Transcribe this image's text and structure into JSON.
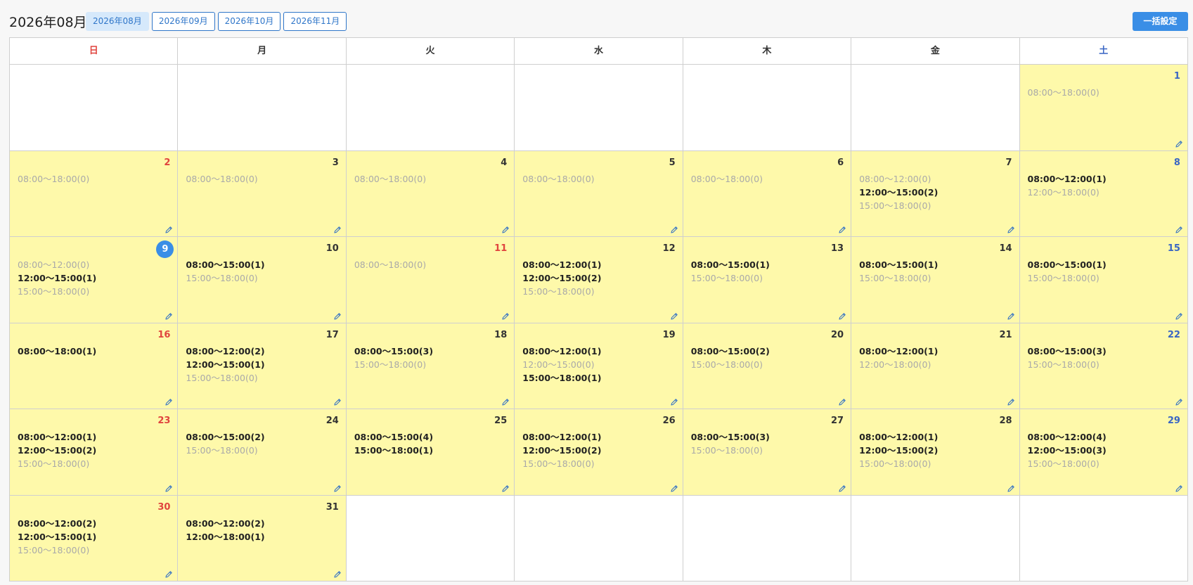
{
  "header": {
    "title": "2026年08月",
    "tabs": [
      {
        "label": "2026年08月",
        "active": true
      },
      {
        "label": "2026年09月",
        "active": false
      },
      {
        "label": "2026年10月",
        "active": false
      },
      {
        "label": "2026年11月",
        "active": false
      }
    ],
    "bulk_button": "一括設定"
  },
  "colors": {
    "filled_cell": "#fef9aa",
    "sunday": "#e0443e",
    "saturday": "#3a66c4",
    "accent": "#3a8ee6"
  },
  "weekdays": [
    {
      "label": "日",
      "kind": "sun"
    },
    {
      "label": "月",
      "kind": ""
    },
    {
      "label": "火",
      "kind": ""
    },
    {
      "label": "水",
      "kind": ""
    },
    {
      "label": "木",
      "kind": ""
    },
    {
      "label": "金",
      "kind": ""
    },
    {
      "label": "土",
      "kind": "sat"
    }
  ],
  "weeks": [
    [
      null,
      null,
      null,
      null,
      null,
      null,
      {
        "day": "1",
        "kind": "sat",
        "slots": [
          {
            "t": "08:00〜18:00(0)",
            "b": false
          }
        ]
      }
    ],
    [
      {
        "day": "2",
        "kind": "sun",
        "slots": [
          {
            "t": "08:00〜18:00(0)",
            "b": false
          }
        ]
      },
      {
        "day": "3",
        "kind": "",
        "slots": [
          {
            "t": "08:00〜18:00(0)",
            "b": false
          }
        ]
      },
      {
        "day": "4",
        "kind": "",
        "slots": [
          {
            "t": "08:00〜18:00(0)",
            "b": false
          }
        ]
      },
      {
        "day": "5",
        "kind": "",
        "slots": [
          {
            "t": "08:00〜18:00(0)",
            "b": false
          }
        ]
      },
      {
        "day": "6",
        "kind": "",
        "slots": [
          {
            "t": "08:00〜18:00(0)",
            "b": false
          }
        ]
      },
      {
        "day": "7",
        "kind": "",
        "slots": [
          {
            "t": "08:00〜12:00(0)",
            "b": false
          },
          {
            "t": "12:00〜15:00(2)",
            "b": true
          },
          {
            "t": "15:00〜18:00(0)",
            "b": false
          }
        ]
      },
      {
        "day": "8",
        "kind": "sat",
        "slots": [
          {
            "t": "08:00〜12:00(1)",
            "b": true
          },
          {
            "t": "12:00〜18:00(0)",
            "b": false
          }
        ]
      }
    ],
    [
      {
        "day": "9",
        "kind": "today",
        "slots": [
          {
            "t": "08:00〜12:00(0)",
            "b": false
          },
          {
            "t": "12:00〜15:00(1)",
            "b": true
          },
          {
            "t": "15:00〜18:00(0)",
            "b": false
          }
        ]
      },
      {
        "day": "10",
        "kind": "",
        "slots": [
          {
            "t": "08:00〜15:00(1)",
            "b": true
          },
          {
            "t": "15:00〜18:00(0)",
            "b": false
          }
        ]
      },
      {
        "day": "11",
        "kind": "sun",
        "slots": [
          {
            "t": "08:00〜18:00(0)",
            "b": false
          }
        ]
      },
      {
        "day": "12",
        "kind": "",
        "slots": [
          {
            "t": "08:00〜12:00(1)",
            "b": true
          },
          {
            "t": "12:00〜15:00(2)",
            "b": true
          },
          {
            "t": "15:00〜18:00(0)",
            "b": false
          }
        ]
      },
      {
        "day": "13",
        "kind": "",
        "slots": [
          {
            "t": "08:00〜15:00(1)",
            "b": true
          },
          {
            "t": "15:00〜18:00(0)",
            "b": false
          }
        ]
      },
      {
        "day": "14",
        "kind": "",
        "slots": [
          {
            "t": "08:00〜15:00(1)",
            "b": true
          },
          {
            "t": "15:00〜18:00(0)",
            "b": false
          }
        ]
      },
      {
        "day": "15",
        "kind": "sat",
        "slots": [
          {
            "t": "08:00〜15:00(1)",
            "b": true
          },
          {
            "t": "15:00〜18:00(0)",
            "b": false
          }
        ]
      }
    ],
    [
      {
        "day": "16",
        "kind": "sun",
        "slots": [
          {
            "t": "08:00〜18:00(1)",
            "b": true
          }
        ]
      },
      {
        "day": "17",
        "kind": "",
        "slots": [
          {
            "t": "08:00〜12:00(2)",
            "b": true
          },
          {
            "t": "12:00〜15:00(1)",
            "b": true
          },
          {
            "t": "15:00〜18:00(0)",
            "b": false
          }
        ]
      },
      {
        "day": "18",
        "kind": "",
        "slots": [
          {
            "t": "08:00〜15:00(3)",
            "b": true
          },
          {
            "t": "15:00〜18:00(0)",
            "b": false
          }
        ]
      },
      {
        "day": "19",
        "kind": "",
        "slots": [
          {
            "t": "08:00〜12:00(1)",
            "b": true
          },
          {
            "t": "12:00〜15:00(0)",
            "b": false
          },
          {
            "t": "15:00〜18:00(1)",
            "b": true
          }
        ]
      },
      {
        "day": "20",
        "kind": "",
        "slots": [
          {
            "t": "08:00〜15:00(2)",
            "b": true
          },
          {
            "t": "15:00〜18:00(0)",
            "b": false
          }
        ]
      },
      {
        "day": "21",
        "kind": "",
        "slots": [
          {
            "t": "08:00〜12:00(1)",
            "b": true
          },
          {
            "t": "12:00〜18:00(0)",
            "b": false
          }
        ]
      },
      {
        "day": "22",
        "kind": "sat",
        "slots": [
          {
            "t": "08:00〜15:00(3)",
            "b": true
          },
          {
            "t": "15:00〜18:00(0)",
            "b": false
          }
        ]
      }
    ],
    [
      {
        "day": "23",
        "kind": "sun",
        "slots": [
          {
            "t": "08:00〜12:00(1)",
            "b": true
          },
          {
            "t": "12:00〜15:00(2)",
            "b": true
          },
          {
            "t": "15:00〜18:00(0)",
            "b": false
          }
        ]
      },
      {
        "day": "24",
        "kind": "",
        "slots": [
          {
            "t": "08:00〜15:00(2)",
            "b": true
          },
          {
            "t": "15:00〜18:00(0)",
            "b": false
          }
        ]
      },
      {
        "day": "25",
        "kind": "",
        "slots": [
          {
            "t": "08:00〜15:00(4)",
            "b": true
          },
          {
            "t": "15:00〜18:00(1)",
            "b": true
          }
        ]
      },
      {
        "day": "26",
        "kind": "",
        "slots": [
          {
            "t": "08:00〜12:00(1)",
            "b": true
          },
          {
            "t": "12:00〜15:00(2)",
            "b": true
          },
          {
            "t": "15:00〜18:00(0)",
            "b": false
          }
        ]
      },
      {
        "day": "27",
        "kind": "",
        "slots": [
          {
            "t": "08:00〜15:00(3)",
            "b": true
          },
          {
            "t": "15:00〜18:00(0)",
            "b": false
          }
        ]
      },
      {
        "day": "28",
        "kind": "",
        "slots": [
          {
            "t": "08:00〜12:00(1)",
            "b": true
          },
          {
            "t": "12:00〜15:00(2)",
            "b": true
          },
          {
            "t": "15:00〜18:00(0)",
            "b": false
          }
        ]
      },
      {
        "day": "29",
        "kind": "sat",
        "slots": [
          {
            "t": "08:00〜12:00(4)",
            "b": true
          },
          {
            "t": "12:00〜15:00(3)",
            "b": true
          },
          {
            "t": "15:00〜18:00(0)",
            "b": false
          }
        ]
      }
    ],
    [
      {
        "day": "30",
        "kind": "sun",
        "slots": [
          {
            "t": "08:00〜12:00(2)",
            "b": true
          },
          {
            "t": "12:00〜15:00(1)",
            "b": true
          },
          {
            "t": "15:00〜18:00(0)",
            "b": false
          }
        ]
      },
      {
        "day": "31",
        "kind": "",
        "slots": [
          {
            "t": "08:00〜12:00(2)",
            "b": true
          },
          {
            "t": "12:00〜18:00(1)",
            "b": true
          }
        ]
      },
      null,
      null,
      null,
      null,
      null
    ]
  ]
}
